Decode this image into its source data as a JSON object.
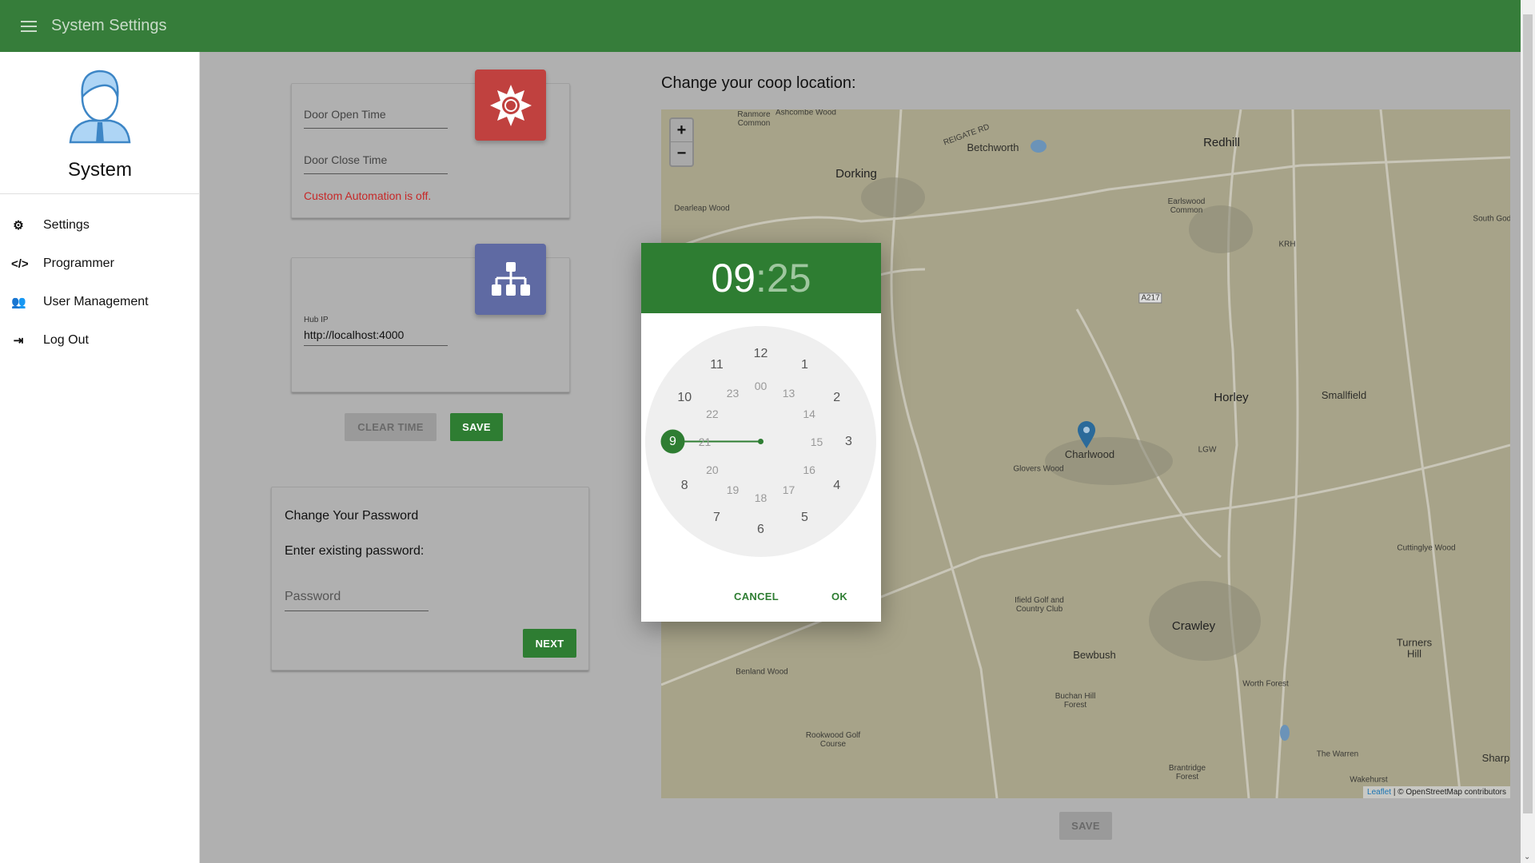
{
  "appbar": {
    "title": "System Settings"
  },
  "sidebar": {
    "name": "System",
    "items": [
      {
        "label": "Settings",
        "icon": "gear-icon"
      },
      {
        "label": "Programmer",
        "icon": "code-icon"
      },
      {
        "label": "User Management",
        "icon": "users-icon"
      },
      {
        "label": "Log Out",
        "icon": "logout-icon"
      }
    ]
  },
  "automation": {
    "open_placeholder": "Door Open Time",
    "close_placeholder": "Door Close Time",
    "status": "Custom Automation is off.",
    "status_color": "#c62828",
    "icon_color": "#c0413f"
  },
  "hub": {
    "label": "Hub IP",
    "value": "http://localhost:4000",
    "icon_color": "#5f6aa3"
  },
  "buttons": {
    "clear_time": "CLEAR TIME",
    "save": "SAVE",
    "next": "NEXT",
    "map_save": "SAVE"
  },
  "password": {
    "title": "Change Your Password",
    "prompt": "Enter existing password:",
    "placeholder": "Password"
  },
  "map": {
    "title": "Change your coop location:",
    "zoom_in": "+",
    "zoom_out": "−",
    "attribution_link": "Leaflet",
    "attribution_text": "| © OpenStreetMap contributors",
    "labels": [
      "Redhill",
      "Dorking",
      "Betchworth",
      "Horley",
      "Smallfield",
      "Charlwood",
      "Glovers Wood",
      "Crawley",
      "Bewbush",
      "Earlswood Common",
      "Ifield Golf and Country Club",
      "Buchan Hill Forest",
      "Worth Forest",
      "Turners Hill",
      "Cuttinglye Wood",
      "Benland Wood",
      "Rookwood Golf Course",
      "The Warren",
      "Brantridge Forest",
      "Wakehurst",
      "Dearleap Wood",
      "Ranmore Common",
      "Sharp",
      "South Godsto",
      "KRH",
      "LGW",
      "A217",
      "REIGATE RD",
      "Ashcombe Wood"
    ]
  },
  "timepicker": {
    "hours": "09",
    "separator": ":",
    "minutes": "25",
    "selected_hour": 9,
    "cancel": "CANCEL",
    "ok": "OK",
    "accent": "#2e7d32",
    "outer": [
      "12",
      "1",
      "2",
      "3",
      "4",
      "5",
      "6",
      "7",
      "8",
      "9",
      "10",
      "11"
    ],
    "inner": [
      "00",
      "13",
      "14",
      "15",
      "16",
      "17",
      "18",
      "19",
      "20",
      "21",
      "22",
      "23"
    ]
  }
}
